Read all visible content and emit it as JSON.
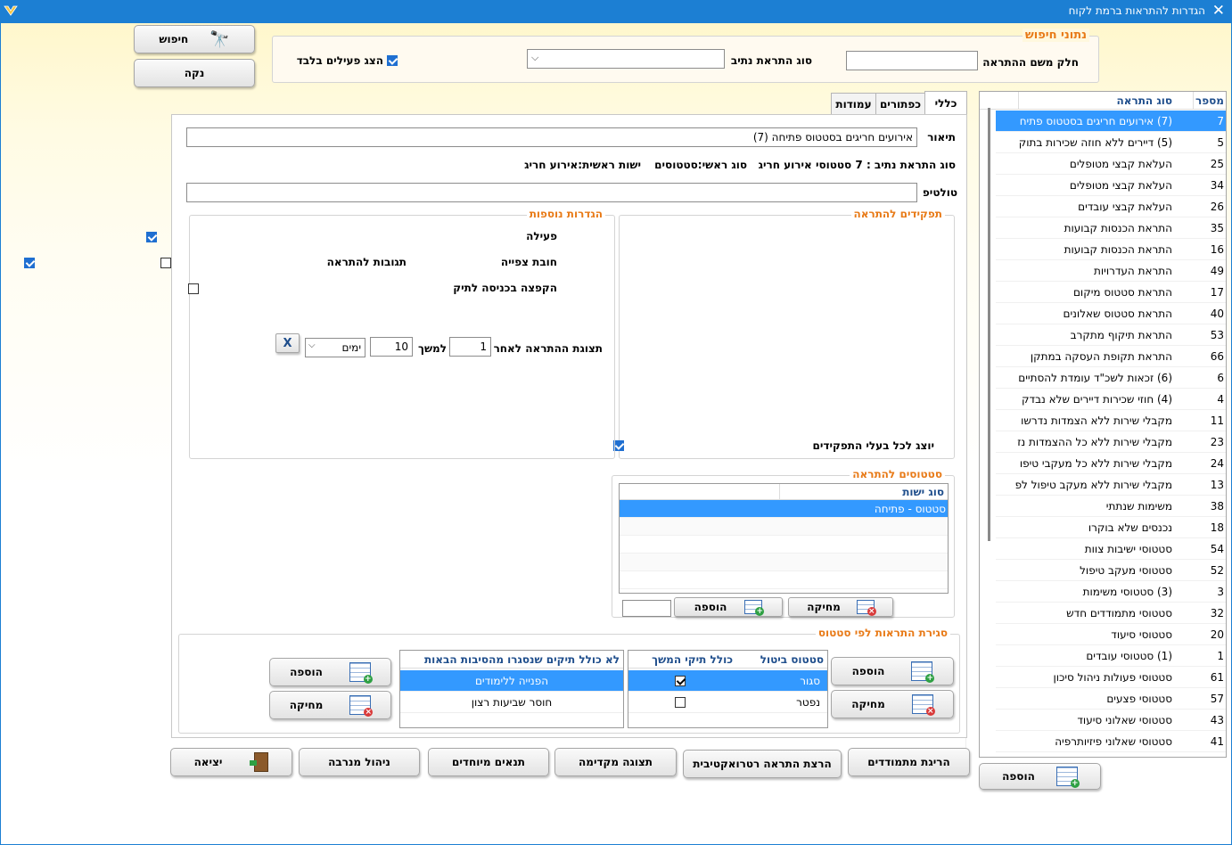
{
  "window": {
    "title": "הגדרות להתראות ברמת לקוח",
    "close_glyph": "✕"
  },
  "search": {
    "legend": "נתוני חיפוש",
    "name_label": "חלק משם ההתראה",
    "name_value": "",
    "type_label": "סוג התראת נתיב",
    "type_value": "",
    "active_only_label": "הצג פעילים בלבד",
    "active_only_checked": true,
    "search_button": "חיפוש",
    "clear_button": "נקה"
  },
  "list": {
    "col_number": "מספר",
    "col_type": "סוג התראה",
    "selected_index": 0,
    "rows": [
      {
        "n": "7",
        "d": "(7) אירועים חריגים בסטטוס פתיח"
      },
      {
        "n": "5",
        "d": "(5) דיירים ללא חוזה שכירות בתוק"
      },
      {
        "n": "25",
        "d": "העלאת קבצי מטופלים"
      },
      {
        "n": "34",
        "d": "העלאת קבצי מטופלים"
      },
      {
        "n": "26",
        "d": "העלאת קבצי עובדים"
      },
      {
        "n": "35",
        "d": "התראת הכנסות קבועות"
      },
      {
        "n": "16",
        "d": "התראת הכנסות קבועות"
      },
      {
        "n": "49",
        "d": "התראת העדרויות"
      },
      {
        "n": "17",
        "d": "התראת סטטוס מיקום"
      },
      {
        "n": "40",
        "d": "התראת סטטוס שאלונים"
      },
      {
        "n": "53",
        "d": "התראת תיקוף מתקרב"
      },
      {
        "n": "66",
        "d": "התראת תקופת העסקה במתקן"
      },
      {
        "n": "6",
        "d": "(6) זכאות לשכ\"ד עומדת להסתיים"
      },
      {
        "n": "4",
        "d": "(4) חוזי שכירות דיירים שלא נבדק"
      },
      {
        "n": "11",
        "d": "מקבלי שירות ללא הצמדות נדרשו"
      },
      {
        "n": "23",
        "d": "מקבלי שירות ללא כל ההצמדות נז"
      },
      {
        "n": "24",
        "d": "מקבלי שירות ללא כל מעקבי טיפו"
      },
      {
        "n": "13",
        "d": "מקבלי שירות ללא מעקב טיפול לפ"
      },
      {
        "n": "38",
        "d": "משימות שנתתי"
      },
      {
        "n": "18",
        "d": "נכנסים שלא בוקרו"
      },
      {
        "n": "54",
        "d": "סטטוסי ישיבות צוות"
      },
      {
        "n": "52",
        "d": "סטטוסי מעקב טיפול"
      },
      {
        "n": "3",
        "d": "(3) סטטוסי משימות"
      },
      {
        "n": "32",
        "d": "סטטוסי מתמודדים חדש"
      },
      {
        "n": "20",
        "d": "סטטוסי סיעוד"
      },
      {
        "n": "1",
        "d": "(1) סטטוסי עובדים"
      },
      {
        "n": "61",
        "d": "סטטוסי פעולות ניהול סיכון"
      },
      {
        "n": "57",
        "d": "סטטוסי פצעים"
      },
      {
        "n": "43",
        "d": "סטטוסי שאלוני סיעוד"
      },
      {
        "n": "41",
        "d": "סטטוסי שאלוני פיזיותרפיה"
      }
    ],
    "add_button": "הוספה"
  },
  "tabs": [
    "כללי",
    "כפתורים",
    "עמודות"
  ],
  "general": {
    "description_label": "תיאור",
    "description_value": "אירועים חריגים בסטטוס פתיחה (7)",
    "route_type": "סוג התראת נתיב : 7 סטטוסי אירוע חריג",
    "main_type": "סוג ראשי:סטטוסים",
    "main_entity": "ישות ראשית:אירוע חריג",
    "tooltip_label": "טולטיפ",
    "tooltip_value": ""
  },
  "roles": {
    "legend": "תפקידים להתראה",
    "show_all_label": "יוצג לכל בעלי התפקידים",
    "show_all_checked": true
  },
  "extra": {
    "legend": "הגדרות נוספות",
    "active_label": "פעילה",
    "active_checked": true,
    "view_required_label": "חובת צפייה",
    "view_required_checked": false,
    "responses_label": "תגובות להתראה",
    "responses_checked": true,
    "popup_label": "הקפצה בכניסה לתיק",
    "popup_checked": false,
    "display_after_label": "תצוגת ההתראה לאחר",
    "display_after_value": "1",
    "duration_label": "למשך",
    "duration_value": "10",
    "unit_value": "ימים",
    "clear_x": "X"
  },
  "statuses": {
    "legend": "סטטוסים להתראה",
    "col_entity": "סוג ישות",
    "rows": [
      "סטטוס - פתיחה"
    ],
    "delete_button": "מחיקה",
    "add_button": "הוספה",
    "small_value": ""
  },
  "closing": {
    "legend": "סגירת התראות לפי סטטוס",
    "col_cancel_status": "סטטוס ביטול",
    "col_include_ongoing": "כולל תיקי המשך",
    "cancel_rows": [
      {
        "status": "סגור",
        "include": true
      },
      {
        "status": "נפטר",
        "include": false
      }
    ],
    "col_exclude": "לא כולל תיקים שנסגרו מהסיבות הבאות",
    "exclude_rows": [
      "הפנייה ללימודים",
      "חוסר שביעות רצון"
    ],
    "add_button": "הוספה",
    "delete_button": "מחיקה",
    "add_button2": "הוספה",
    "delete_button2": "מחיקה"
  },
  "footer": {
    "kill_button": "הריגת מתמודדים",
    "retro_button": "הרצת התראה רטרואקטיבית",
    "preview_button": "תצוגה מקדימה",
    "special_button": "תנאים מיוחדים",
    "admin_button": "ניהול מנרבה",
    "exit_button": "יציאה"
  },
  "colors": {
    "accent": "#1c7fd3",
    "selection": "#3399ff",
    "legend": "#e87a17",
    "header_text": "#1f4e8c"
  }
}
